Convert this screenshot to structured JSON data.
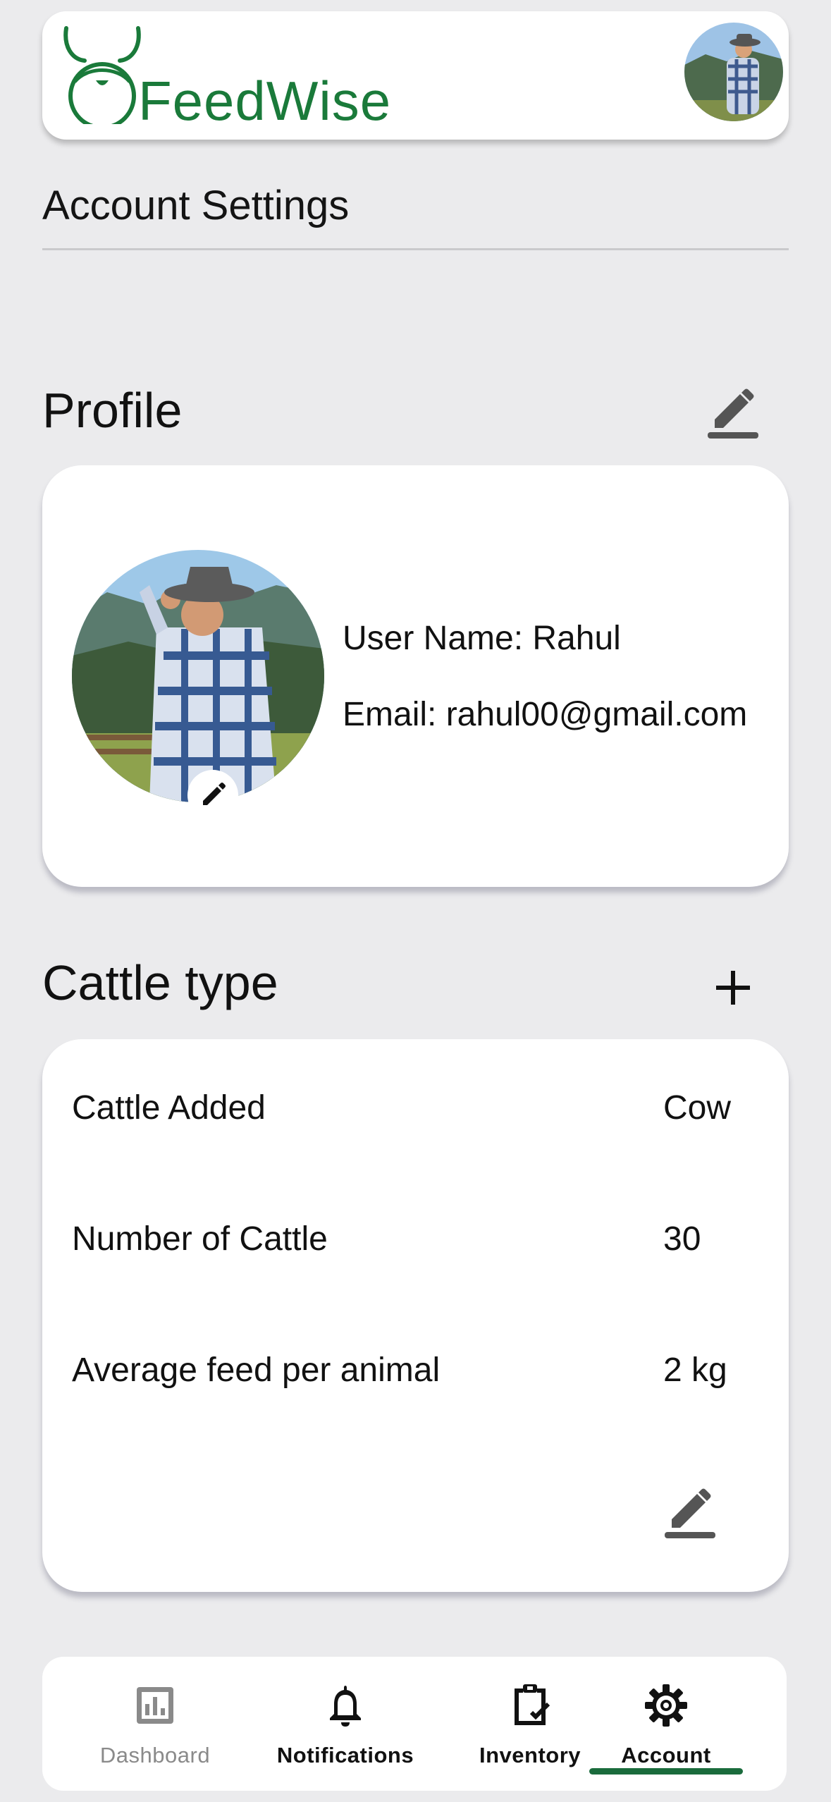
{
  "brand": {
    "name": "FeedWise",
    "color": "#1a7a3a"
  },
  "page": {
    "title": "Account Settings"
  },
  "profile": {
    "heading": "Profile",
    "user_name": "User Name: Rahul",
    "email": "Email: rahul00@gmail.com"
  },
  "cattle": {
    "heading": "Cattle type",
    "rows": [
      {
        "label": "Cattle Added",
        "value": "Cow"
      },
      {
        "label": "Number of Cattle",
        "value": "30"
      },
      {
        "label": "Average feed per animal",
        "value": "2 kg"
      }
    ]
  },
  "nav": {
    "items": [
      {
        "label": "Dashboard",
        "icon": "bar-chart-icon",
        "active": false
      },
      {
        "label": "Notifications",
        "icon": "bell-icon",
        "active": false
      },
      {
        "label": "Inventory",
        "icon": "clipboard-check-icon",
        "active": false
      },
      {
        "label": "Account",
        "icon": "gear-icon",
        "active": true
      }
    ],
    "active_color": "#1a6b3c"
  }
}
